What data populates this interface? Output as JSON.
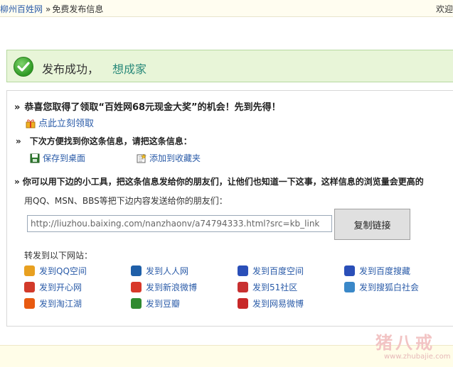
{
  "topbar": {
    "home_link": "柳州百姓网",
    "separator": "»",
    "current": "免费发布信息",
    "welcome": "欢迎"
  },
  "success": {
    "message": "发布成功，",
    "title_link": "想成家"
  },
  "prize": {
    "title": "恭喜您取得了领取“百姓网68元现金大奖”的机会！先到先得！",
    "claim_link": "点此立刻领取"
  },
  "save": {
    "title": "下次方便找到你这条信息，请把这条信息：",
    "desktop_link": "保存到桌面",
    "favorite_link": "添加到收藏夹"
  },
  "share_tools": {
    "title": "你可以用下边的小工具，把这条信息发给你的朋友们，让他们也知道一下这事，这样信息的浏览量会更高的",
    "instruction": "用QQ、MSN、BBS等把下边内容发送给你的朋友们：",
    "url_value": "http://liuzhou.baixing.com/nanzhaonv/a74794333.html?src=kb_link",
    "copy_button": "复制链接"
  },
  "forward": {
    "title": "转发到以下网站：",
    "sites": [
      {
        "label": "发到QQ空间",
        "icon": "qzone-icon",
        "color": "#e8a020"
      },
      {
        "label": "发到人人网",
        "icon": "renren-icon",
        "color": "#1f5fa8"
      },
      {
        "label": "发到百度空间",
        "icon": "baidu-space-icon",
        "color": "#2a4fb8"
      },
      {
        "label": "发到百度搜藏",
        "icon": "baidu-cang-icon",
        "color": "#2a4fb8"
      },
      {
        "label": "发到开心网",
        "icon": "kaixin-icon",
        "color": "#d23a2a"
      },
      {
        "label": "发到新浪微博",
        "icon": "sina-weibo-icon",
        "color": "#d8382a"
      },
      {
        "label": "发到51社区",
        "icon": "51-icon",
        "color": "#c83030"
      },
      {
        "label": "发到搜狐白社会",
        "icon": "sohu-icon",
        "color": "#3a88c8"
      },
      {
        "label": "发到淘江湖",
        "icon": "taojianghu-icon",
        "color": "#e85a10"
      },
      {
        "label": "发到豆瓣",
        "icon": "douban-icon",
        "color": "#2f8a2f"
      },
      {
        "label": "发到网易微博",
        "icon": "netease-icon",
        "color": "#c82828"
      }
    ]
  },
  "watermark": {
    "text": "猪八戒",
    "url": "www.zhubajie.com"
  }
}
